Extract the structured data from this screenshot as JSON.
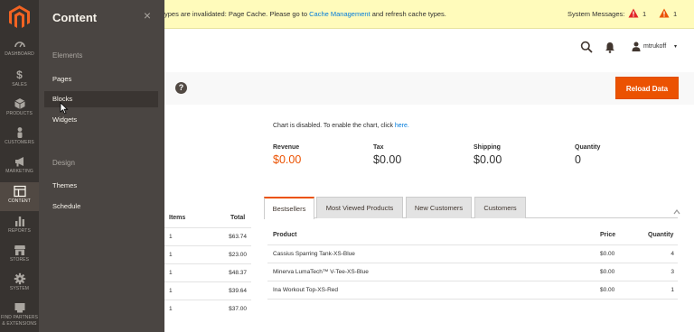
{
  "nav": {
    "items": [
      {
        "label": "DASHBOARD",
        "icon": "dashboard-icon"
      },
      {
        "label": "SALES",
        "icon": "dollar-icon"
      },
      {
        "label": "PRODUCTS",
        "icon": "cube-icon"
      },
      {
        "label": "CUSTOMERS",
        "icon": "person-icon"
      },
      {
        "label": "MARKETING",
        "icon": "megaphone-icon"
      },
      {
        "label": "CONTENT",
        "icon": "layout-icon"
      },
      {
        "label": "REPORTS",
        "icon": "bar-chart-icon"
      },
      {
        "label": "STORES",
        "icon": "store-icon"
      },
      {
        "label": "SYSTEM",
        "icon": "gear-icon"
      },
      {
        "label": "FIND PARTNERS",
        "label2": "& EXTENSIONS",
        "icon": "partners-icon"
      }
    ]
  },
  "flyout": {
    "title": "Content",
    "close": "×",
    "sections": [
      {
        "title": "Elements",
        "items": [
          "Pages",
          "Blocks",
          "Widgets"
        ]
      },
      {
        "title": "Design",
        "items": [
          "Themes",
          "Schedule"
        ]
      }
    ]
  },
  "message": {
    "text_before": "ypes are invalidated: Page Cache. Please go to ",
    "link": "Cache Management",
    "text_after": " and refresh cache types.",
    "system_label": "System Messages:",
    "count_error": "1",
    "count_warning": "1"
  },
  "header": {
    "username": "mtrukoff",
    "caret": "▾"
  },
  "actionbar": {
    "help": "?",
    "reload_label": "Reload Data"
  },
  "chart_notice": {
    "text": "Chart is disabled. To enable the chart, click ",
    "link": "here."
  },
  "totals": [
    {
      "label": "Revenue",
      "value": "$0.00"
    },
    {
      "label": "Tax",
      "value": "$0.00"
    },
    {
      "label": "Shipping",
      "value": "$0.00"
    },
    {
      "label": "Quantity",
      "value": "0"
    }
  ],
  "orders": {
    "headers": {
      "items": "Items",
      "total": "Total"
    },
    "rows": [
      {
        "items": "1",
        "total": "$63.74"
      },
      {
        "items": "1",
        "total": "$23.00"
      },
      {
        "items": "1",
        "total": "$48.37"
      },
      {
        "items": "1",
        "total": "$39.64"
      },
      {
        "items": "1",
        "total": "$37.00"
      }
    ]
  },
  "tabs": [
    "Bestsellers",
    "Most Viewed Products",
    "New Customers",
    "Customers"
  ],
  "bestsellers": {
    "headers": {
      "product": "Product",
      "price": "Price",
      "quantity": "Quantity"
    },
    "rows": [
      {
        "product": "Cassius Sparring Tank-XS-Blue",
        "price": "$0.00",
        "quantity": "4"
      },
      {
        "product": "Minerva LumaTech™ V-Tee-XS-Blue",
        "price": "$0.00",
        "quantity": "3"
      },
      {
        "product": "Ina Workout Top-XS-Red",
        "price": "$0.00",
        "quantity": "1"
      }
    ]
  },
  "colors": {
    "accent": "#eb5202",
    "nav_bg": "#373330",
    "flyout_bg": "#4a4542",
    "message_bg": "#fffbbb",
    "link": "#007bdb"
  }
}
